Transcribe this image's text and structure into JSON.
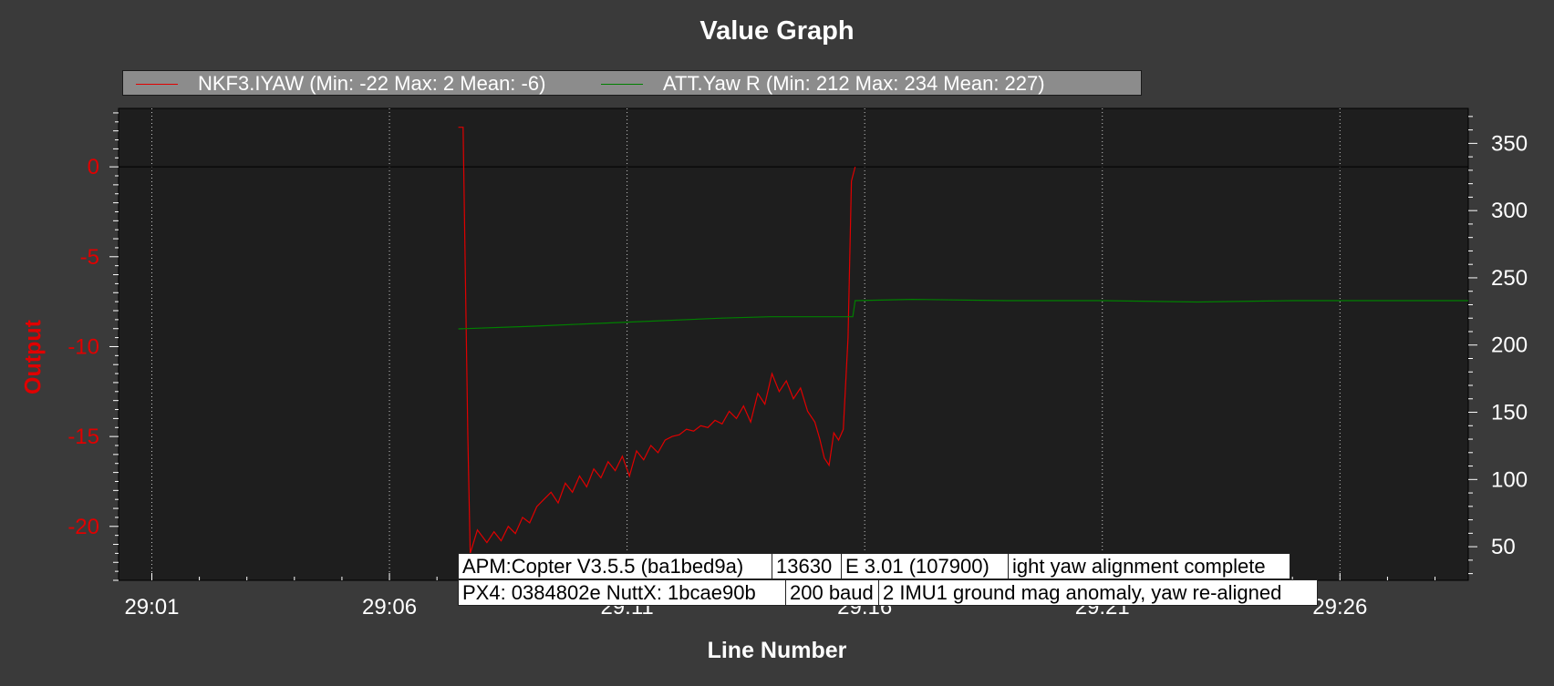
{
  "chart_data": {
    "type": "line",
    "title": "Value Graph",
    "xlabel": "Line Number",
    "ylabel": "Output",
    "x_tick_labels": [
      "29:01",
      "29:06",
      "29:11",
      "29:16",
      "29:21",
      "29:26"
    ],
    "x_tick_values": [
      0,
      5,
      10,
      15,
      20,
      25
    ],
    "xlim": [
      -0.7,
      27.7
    ],
    "y_left": {
      "ticks": [
        0,
        -5,
        -10,
        -15,
        -20
      ],
      "ylim": [
        -23,
        3.25
      ],
      "color": "#e00000"
    },
    "y_right": {
      "ticks": [
        50,
        100,
        150,
        200,
        250,
        300,
        350
      ],
      "ylim": [
        25,
        376
      ],
      "color": "#ffffff"
    },
    "grid": true,
    "legend_position": "top",
    "series": [
      {
        "name": "NKF3.IYAW (Min: -22 Max: 2 Mean: -6)",
        "color": "#e00000",
        "axis": "left",
        "x": [
          6.45,
          6.55,
          6.65,
          6.7,
          6.85,
          7.05,
          7.2,
          7.35,
          7.5,
          7.65,
          7.8,
          7.95,
          8.1,
          8.25,
          8.4,
          8.55,
          8.7,
          8.85,
          9.0,
          9.15,
          9.3,
          9.45,
          9.6,
          9.75,
          9.9,
          10.05,
          10.2,
          10.35,
          10.5,
          10.65,
          10.8,
          10.95,
          11.1,
          11.25,
          11.4,
          11.55,
          11.7,
          11.85,
          12.0,
          12.15,
          12.3,
          12.45,
          12.6,
          12.75,
          12.9,
          13.05,
          13.2,
          13.35,
          13.5,
          13.65,
          13.8,
          13.95,
          14.05,
          14.15,
          14.25,
          14.35,
          14.45,
          14.55,
          14.65,
          14.72,
          14.8
        ],
        "values": [
          2.2,
          2.2,
          -15.0,
          -21.5,
          -20.2,
          -20.9,
          -20.3,
          -20.8,
          -20.0,
          -20.4,
          -19.5,
          -19.8,
          -18.9,
          -18.5,
          -18.1,
          -18.7,
          -17.6,
          -18.1,
          -17.2,
          -17.8,
          -16.8,
          -17.3,
          -16.4,
          -16.9,
          -16.1,
          -17.2,
          -15.8,
          -16.3,
          -15.5,
          -15.9,
          -15.2,
          -15.0,
          -14.9,
          -14.6,
          -14.7,
          -14.4,
          -14.5,
          -14.1,
          -14.3,
          -13.6,
          -14.0,
          -13.3,
          -14.2,
          -12.6,
          -13.2,
          -11.5,
          -12.5,
          -11.9,
          -12.9,
          -12.3,
          -13.6,
          -14.2,
          -15.1,
          -16.2,
          -16.6,
          -14.8,
          -15.2,
          -14.6,
          -9.5,
          -0.8,
          0.0
        ]
      },
      {
        "name": "ATT.Yaw R (Min: 212 Max: 234 Mean: 227)",
        "color": "#008000",
        "axis": "right",
        "x": [
          6.45,
          8.0,
          10.0,
          12.0,
          13.0,
          14.0,
          14.5,
          14.75,
          14.8,
          16.0,
          18.0,
          20.0,
          22.0,
          24.0,
          26.0,
          27.7
        ],
        "values": [
          212,
          214,
          217,
          220,
          221,
          221,
          221,
          221,
          233,
          234,
          233,
          233,
          232,
          233,
          233,
          233
        ]
      }
    ],
    "messages": [
      [
        "APM:Copter V3.5.5 (ba1bed9a)",
        "13630",
        "E 3.01 (107900)",
        "ight yaw alignment complete"
      ],
      [
        "PX4: 0384802e NuttX: 1bcae90b",
        "200 baud",
        "2 IMU1 ground mag anomaly, yaw re-aligned"
      ]
    ]
  }
}
